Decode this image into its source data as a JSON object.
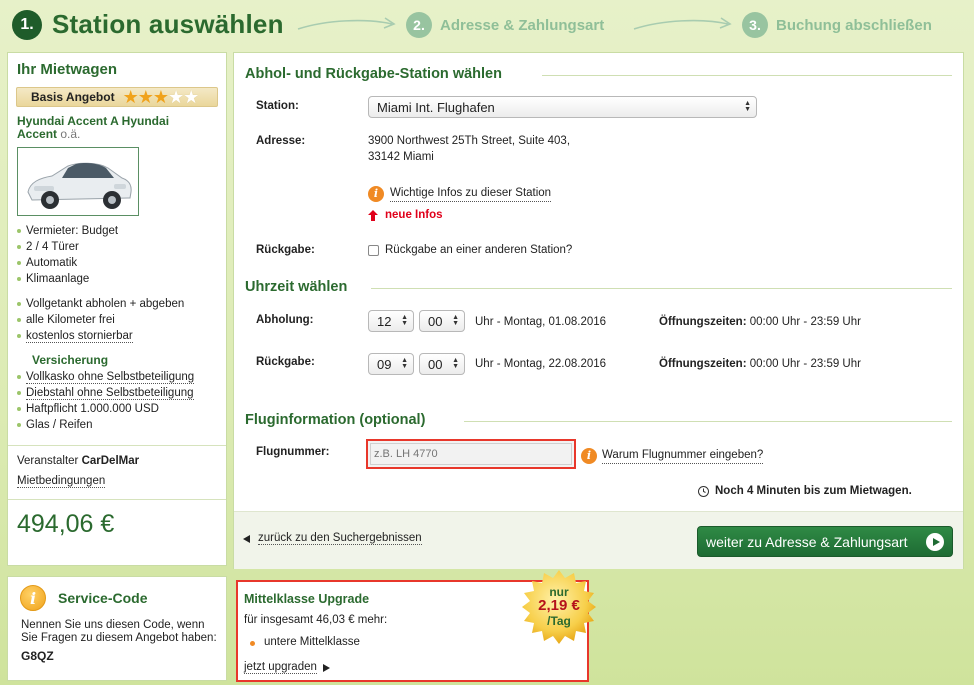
{
  "steps": [
    {
      "num": "1.",
      "title": "Station auswählen"
    },
    {
      "num": "2.",
      "title": "Adresse & Zahlungsart"
    },
    {
      "num": "3.",
      "title": "Buchung abschließen"
    }
  ],
  "car": {
    "heading": "Ihr Mietwagen",
    "badge": "Basis Angebot",
    "stars_filled": 3,
    "stars_total": 5,
    "name": "Hyundai Accent A Hyundai Accent",
    "similar": "o.ä.",
    "features": [
      "Vermieter: Budget",
      "2 / 4 Türer",
      "Automatik",
      "Klimaanlage"
    ],
    "features2": [
      "Vollgetankt abholen + abgeben",
      "alle Kilometer frei",
      "kostenlos stornierbar"
    ],
    "insurance_title": "Versicherung",
    "insurance": [
      "Vollkasko ohne Selbstbeteiligung",
      "Diebstahl ohne Selbstbeteiligung",
      "Haftpflicht 1.000.000 USD",
      "Glas / Reifen"
    ],
    "vendor_label": "Veranstalter",
    "vendor": "CarDelMar",
    "terms": "Mietbedingungen",
    "price": "494,06 €"
  },
  "service": {
    "title": "Service-Code",
    "text": "Nennen Sie uns diesen Code, wenn Sie Fragen zu diesem Angebot haben:",
    "code": "G8QZ"
  },
  "station": {
    "section_title": "Abhol- und Rückgabe-Station wählen",
    "station_label": "Station:",
    "station_value": "Miami Int. Flughafen",
    "address_label": "Adresse:",
    "address_line1": "3900 Northwest 25Th Street, Suite 403,",
    "address_line2": "33142 Miami",
    "info_link": "Wichtige Infos zu dieser Station",
    "new_info": "neue Infos",
    "return_label": "Rückgabe:",
    "return_checkbox": "Rückgabe an einer anderen Station?"
  },
  "time": {
    "section_title": "Uhrzeit wählen",
    "pickup_label": "Abholung:",
    "pickup_hour": "12",
    "pickup_min": "00",
    "pickup_date": "Uhr - Montag, 01.08.2016",
    "pickup_hours_label": "Öffnungszeiten:",
    "pickup_hours": "00:00 Uhr - 23:59 Uhr",
    "return_label": "Rückgabe:",
    "return_hour": "09",
    "return_min": "00",
    "return_date": "Uhr - Montag, 22.08.2016",
    "return_hours_label": "Öffnungszeiten:",
    "return_hours": "00:00 Uhr - 23:59 Uhr"
  },
  "flight": {
    "section_title": "Fluginformation (optional)",
    "label": "Flugnummer:",
    "placeholder": "z.B. LH 4770",
    "why_link": "Warum Flugnummer eingeben?",
    "timer": "Noch 4 Minuten bis zum Mietwagen."
  },
  "nav": {
    "back": "zurück zu den Suchergebnissen",
    "next": "weiter zu Adresse & Zahlungsart"
  },
  "upgrade": {
    "title": "Mittelklasse Upgrade",
    "text": "für insgesamt 46,03 € mehr:",
    "bullet": "untere Mittelklasse",
    "link": "jetzt upgraden",
    "seal_top": "nur",
    "seal_price": "2,19 €",
    "seal_unit": "/Tag"
  },
  "colors": {
    "brand_green": "#2b6a2f",
    "accent_orange": "#f08a24",
    "alert_red": "#e8372b"
  }
}
